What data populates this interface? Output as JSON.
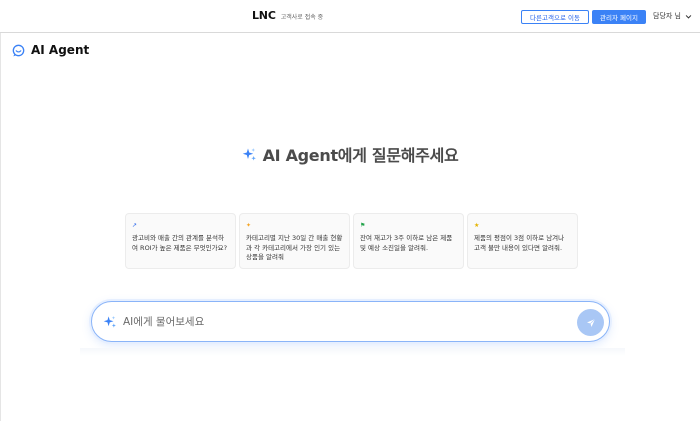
{
  "header": {
    "brand": "LNC",
    "brand_status": "고객사로 접속 중",
    "switch_customer_label": "다른고객으로 이동",
    "admin_page_label": "관리자 페이지",
    "user_name": "담당자 님"
  },
  "agent": {
    "title": "AI Agent"
  },
  "hero": {
    "text": "AI Agent에게 질문해주세요"
  },
  "suggestions": [
    {
      "icon": "chart-up-icon",
      "icon_glyph": "↗",
      "icon_color": "#2563eb",
      "text": "광고비와 매출 간의 관계를 분석하여 ROI가 높은 제품은 무엇인가요?"
    },
    {
      "icon": "sparkle-icon",
      "icon_glyph": "✦",
      "icon_color": "#f5a524",
      "text": "카테고리별 지난 30일 간 매출 현황과 각 카테고리에서 가장 인기 있는 상품을 알려줘"
    },
    {
      "icon": "flag-icon",
      "icon_glyph": "⚑",
      "icon_color": "#22a34a",
      "text": "잔여 재고가 3주 이하로 남은 제품 및 예상 소진일을 알려줘."
    },
    {
      "icon": "star-icon",
      "icon_glyph": "★",
      "icon_color": "#e5b400",
      "text": "제품의 평점이 3점 이하로 남겨나 고객 불만 내용이 있다면 알려줘."
    }
  ],
  "composer": {
    "placeholder": "AI에게 물어보세요",
    "value": ""
  },
  "colors": {
    "accent": "#3b82f6",
    "send_button": "#a9c7f5"
  }
}
